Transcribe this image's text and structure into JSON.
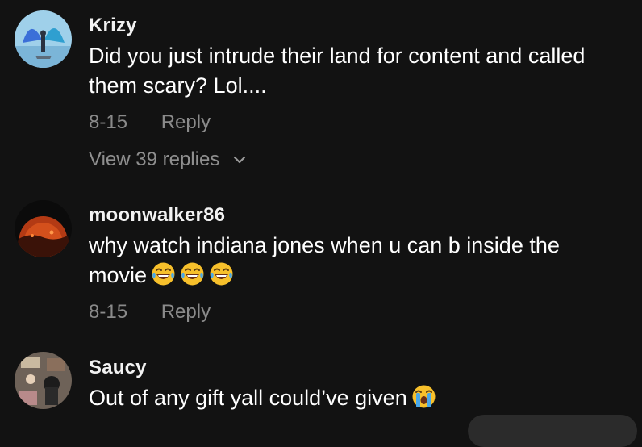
{
  "comments": [
    {
      "username": "Krizy",
      "text_line1": "Did you just intrude their land for content and called",
      "text_line2": "them scary? Lol....",
      "date": "8-15",
      "reply_label": "Reply",
      "replies_label": "View 39 replies"
    },
    {
      "username": "moonwalker86",
      "text_line1": "why watch indiana jones when u can b inside the",
      "text_line2": "movie",
      "emojis": [
        "face-with-tears-of-joy-icon",
        "face-with-tears-of-joy-icon",
        "face-with-tears-of-joy-icon"
      ],
      "date": "8-15",
      "reply_label": "Reply"
    },
    {
      "username": "Saucy",
      "text_line1": "Out of any gift yall could’ve given",
      "emojis": [
        "loudly-crying-face-icon"
      ]
    }
  ],
  "colors": {
    "background": "#121212",
    "text_primary": "#ffffff",
    "text_secondary": "#8a8a8a",
    "emoji_yellow": "#f7c02b"
  }
}
